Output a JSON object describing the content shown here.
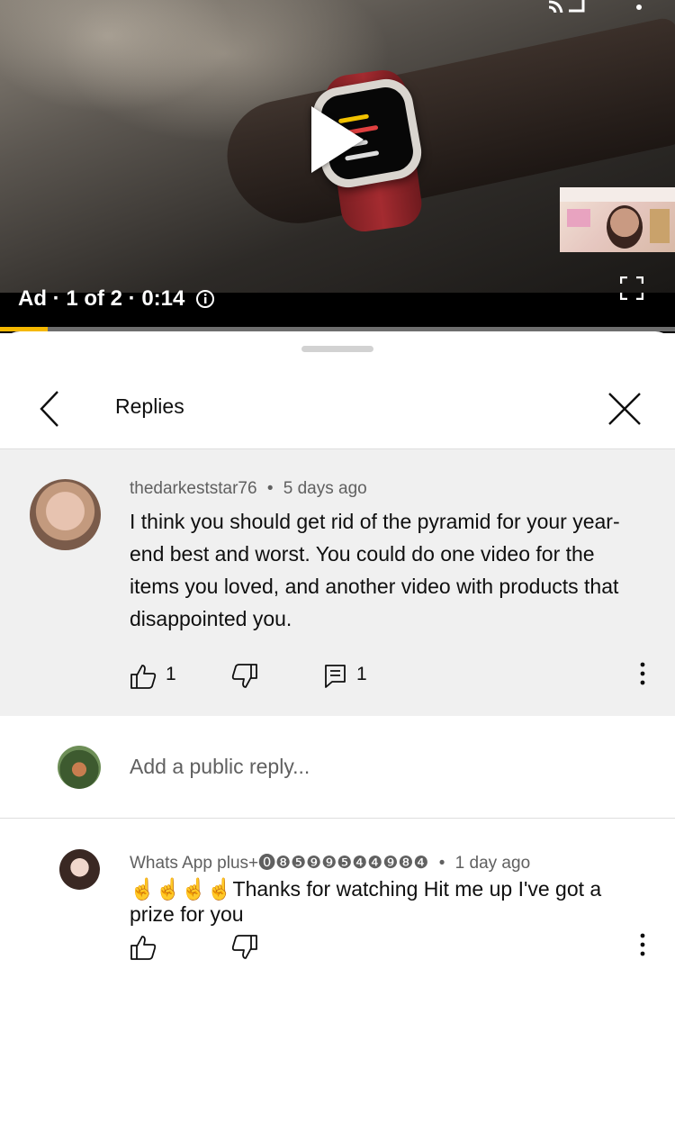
{
  "player": {
    "ad_label": "Ad · 1 of 2 · 0:14",
    "progress": 0.07,
    "icons": [
      "cast-icon",
      "more-vert-icon",
      "play-icon",
      "info-icon",
      "fullscreen-icon"
    ]
  },
  "sheet": {
    "header": {
      "title": "Replies"
    }
  },
  "main_comment": {
    "author": "thedarkeststar76",
    "separator": "•",
    "time": "5 days ago",
    "text": "I think you should get rid of the pyramid for your year-end best and worst. You could do one video for the items you loved, and another video with products that disappointed you.",
    "likes": "1",
    "replies": "1"
  },
  "add_reply": {
    "placeholder": "Add a public reply..."
  },
  "reply": {
    "author": "Whats App plus+⓿❽❺❾❾❺❹❹❾❽❹",
    "separator": "•",
    "time": "1 day ago",
    "text": "☝️☝️☝️☝️Thanks for watching Hit me up I've got a prize for you"
  },
  "colors": {
    "accent_progress": "#f5b800",
    "secondary_text": "#606060",
    "comment_bg": "#f0f0f0"
  }
}
